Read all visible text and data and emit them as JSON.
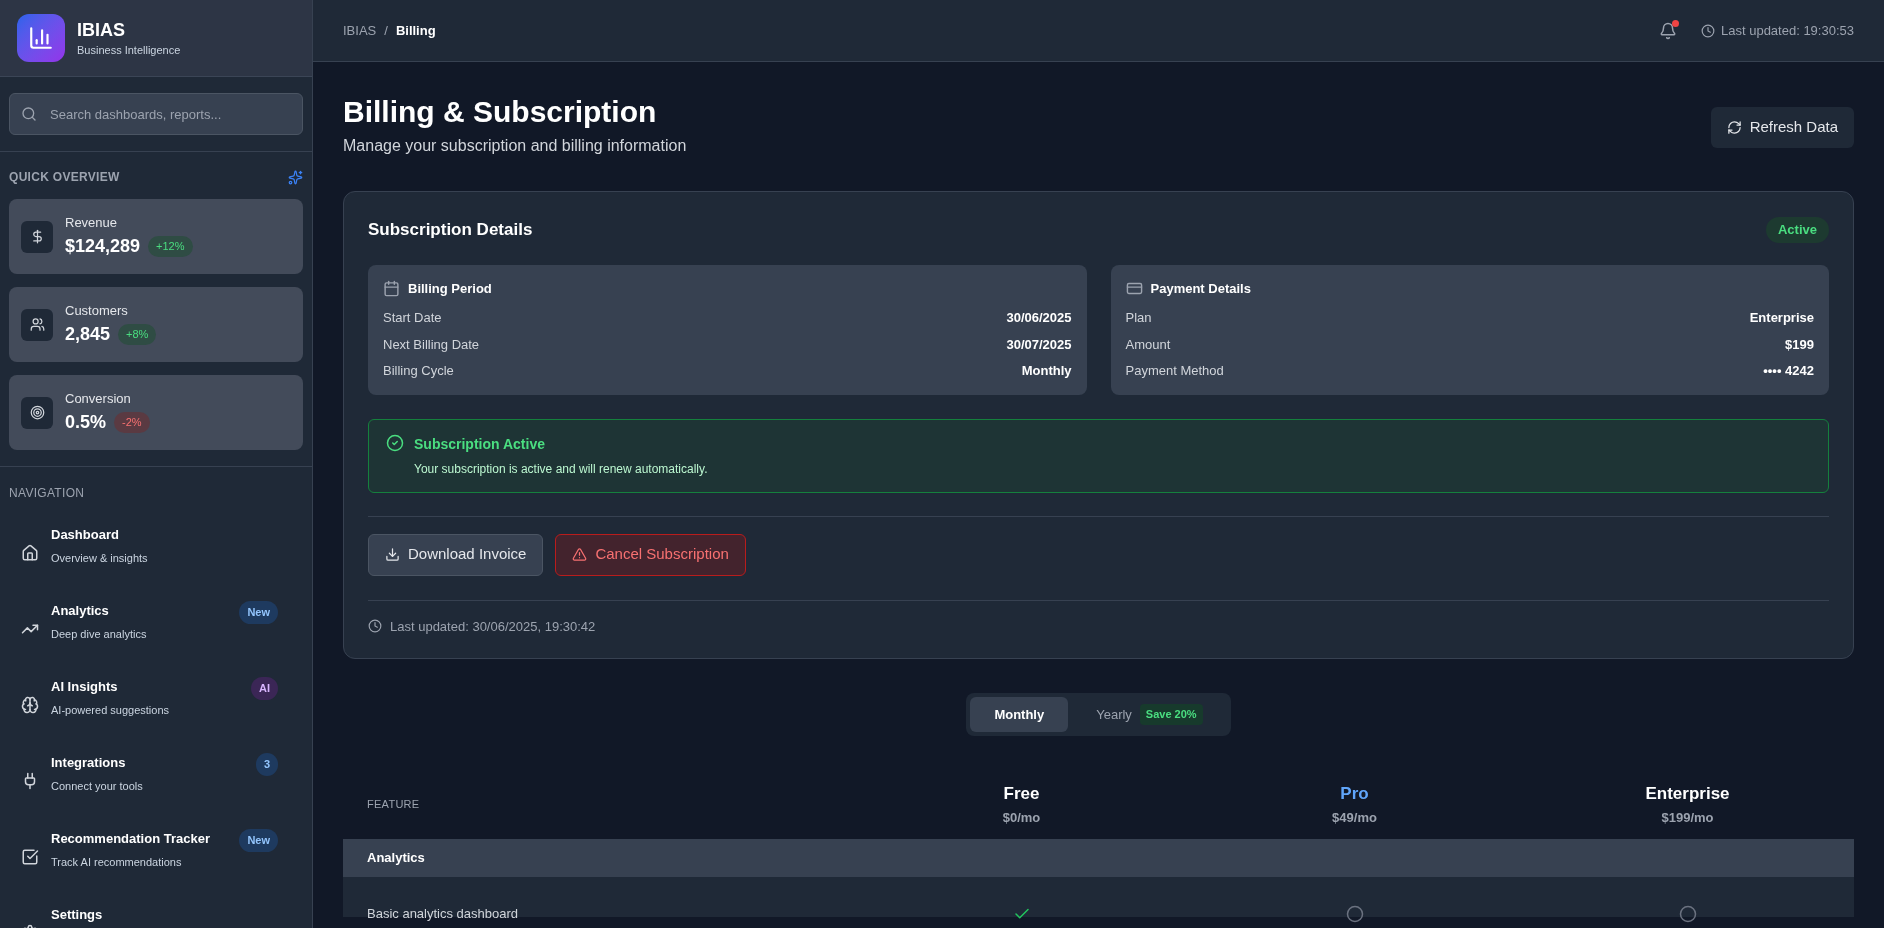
{
  "brand": {
    "name": "IBIAS",
    "tagline": "Business Intelligence"
  },
  "search": {
    "placeholder": "Search dashboards, reports..."
  },
  "quick_overview": {
    "title": "QUICK OVERVIEW",
    "cards": [
      {
        "kind": "revenue",
        "label": "Revenue",
        "value": "$124,289",
        "change": "+12%",
        "color": "#2f4c44"
      },
      {
        "kind": "customers",
        "label": "Customers",
        "value": "2,845",
        "change": "+8%",
        "color": "#2f4c44"
      },
      {
        "kind": "conversion",
        "label": "Conversion",
        "value": "0.5%",
        "change": "-2%",
        "color": "#5a3a42"
      }
    ]
  },
  "navigation": {
    "title": "NAVIGATION",
    "items": [
      {
        "kind": "home",
        "label": "Dashboard",
        "description": "Overview & insights"
      },
      {
        "kind": "trend",
        "label": "Analytics",
        "description": "Deep dive analytics",
        "badge": "New",
        "color": "#1e3a5f"
      },
      {
        "kind": "brain",
        "label": "AI Insights",
        "description": "AI-powered suggestions",
        "badge": "AI",
        "color": "#3b2656"
      },
      {
        "kind": "plug",
        "label": "Integrations",
        "description": "Connect your tools",
        "badge": "3",
        "color": "#1e3a5f"
      },
      {
        "kind": "check",
        "label": "Recommendation Tracker",
        "description": "Track AI recommendations",
        "badge": "New",
        "color": "#1e3a5f"
      },
      {
        "kind": "gear",
        "label": "Settings"
      }
    ]
  },
  "header": {
    "breadcrumb": [
      "IBIAS",
      "Billing"
    ],
    "separator": "/",
    "notification_dot": true,
    "last_updated": "Last updated: 19:30:53"
  },
  "page": {
    "title": "Billing & Subscription",
    "subtitle": "Manage your subscription and billing information",
    "refresh_button": "Refresh Data"
  },
  "subscription": {
    "title": "Subscription Details",
    "status": "Active",
    "billing_period": {
      "title": "Billing Period",
      "rows": [
        {
          "label": "Start Date",
          "value": "30/06/2025"
        },
        {
          "label": "Next Billing Date",
          "value": "30/07/2025"
        },
        {
          "label": "Billing Cycle",
          "value": "Monthly"
        }
      ]
    },
    "payment_details": {
      "title": "Payment Details",
      "rows": [
        {
          "label": "Plan",
          "value": "Enterprise"
        },
        {
          "label": "Amount",
          "value": "$199"
        },
        {
          "label": "Payment Method",
          "value": "•••• 4242"
        }
      ]
    },
    "alert": {
      "title": "Subscription Active",
      "message": "Your subscription is active and will renew automatically."
    },
    "buttons": [
      {
        "kind": "download",
        "label": "Download Invoice"
      },
      {
        "kind": "cancel",
        "label": "Cancel Subscription"
      }
    ],
    "last_updated": "Last updated: 30/06/2025, 19:30:42"
  },
  "billing_toggle": [
    {
      "label": "Monthly",
      "selected": true
    },
    {
      "label": "Yearly",
      "selected": false,
      "badge": "Save 20%"
    }
  ],
  "plans_table": {
    "feature_header": "FEATURE",
    "plans": [
      {
        "name": "Free",
        "price": "$0/mo",
        "highlighted": false
      },
      {
        "name": "Pro",
        "price": "$49/mo",
        "highlighted": true
      },
      {
        "name": "Enterprise",
        "price": "$199/mo",
        "highlighted": false
      }
    ],
    "sections": [
      {
        "title": "Analytics",
        "rows": [
          {
            "feature": "Basic analytics dashboard",
            "included": [
              true,
              false,
              false
            ]
          }
        ]
      }
    ]
  }
}
